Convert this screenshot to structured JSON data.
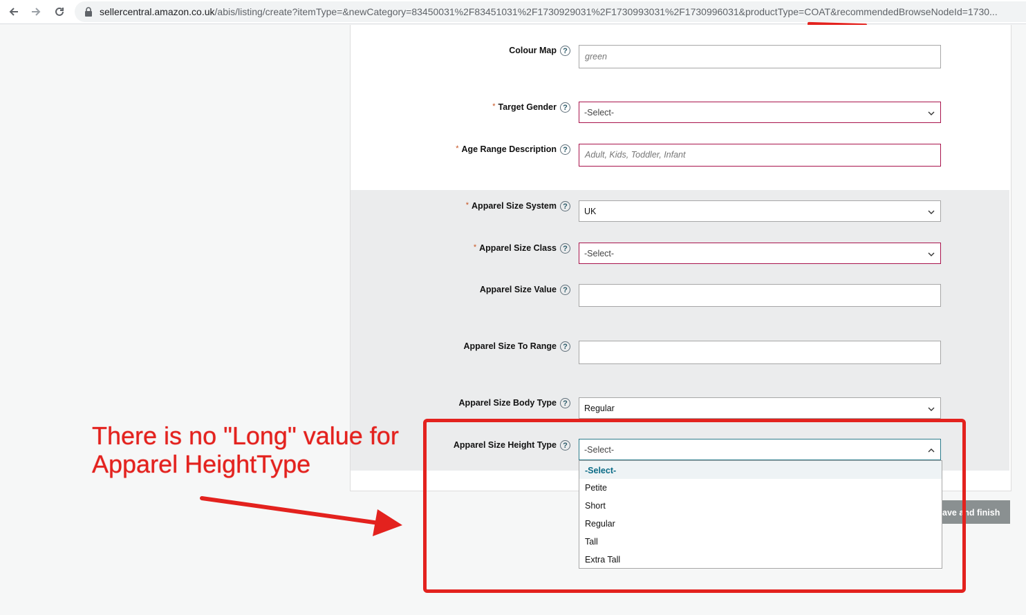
{
  "browser": {
    "url_prefix": "sellercentral.amazon.co.uk",
    "url_rest": "/abis/listing/create?itemType=&newCategory=83450031%2F83451031%2F1730929031%2F1730993031%2F1730996031&productType=COAT&recommendedBrowseNodeId=1730..."
  },
  "form": {
    "colour_map": {
      "label": "Colour Map",
      "value": "green"
    },
    "target_gender": {
      "label": "Target Gender",
      "value": "-Select-"
    },
    "age_range": {
      "label": "Age Range Description",
      "placeholder": "Adult, Kids, Toddler, Infant"
    },
    "size_system": {
      "label": "Apparel Size System",
      "value": "UK"
    },
    "size_class": {
      "label": "Apparel Size Class",
      "value": "-Select-"
    },
    "size_value": {
      "label": "Apparel Size Value",
      "value": ""
    },
    "size_to_range": {
      "label": "Apparel Size To Range",
      "value": ""
    },
    "body_type": {
      "label": "Apparel Size Body Type",
      "value": "Regular"
    },
    "height_type": {
      "label": "Apparel Size Height Type",
      "value": "-Select-",
      "options": [
        "-Select-",
        "Petite",
        "Short",
        "Regular",
        "Tall",
        "Extra Tall"
      ]
    },
    "required_mark": "*",
    "help_glyph": "?"
  },
  "buttons": {
    "save_finish": "ave and finish"
  },
  "annotation": {
    "text_line1": "There is no \"Long\" value for",
    "text_line2": "Apparel HeightType",
    "color": "#e3221e"
  }
}
